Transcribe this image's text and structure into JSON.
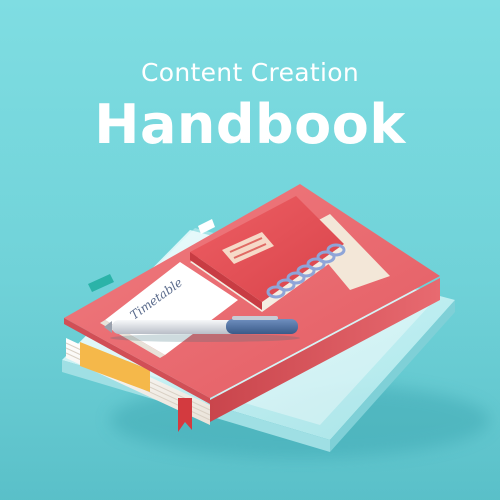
{
  "header": {
    "subtitle": "Content Creation",
    "title": "Handbook"
  },
  "illustration": {
    "notebook_script": "Timetable",
    "icons": [
      "book-stack-icon",
      "spiral-notebook-icon",
      "pen-icon",
      "bookmark-ribbon-icon"
    ],
    "colors": {
      "background": "#6fd2d8",
      "book_cover": "#e8636a",
      "notebook_cover": "#e04a4f",
      "pages": "#f6efe6",
      "bookmark": "#d33a3f",
      "sticky_note": "#f5b84a",
      "tab_teal": "#2bb3a8",
      "pen_body": "#e6e8ec",
      "pen_cap": "#4e6fa0"
    }
  }
}
